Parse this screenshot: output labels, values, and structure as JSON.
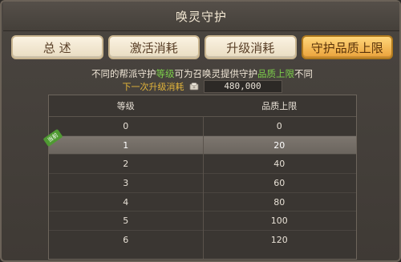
{
  "window": {
    "title": "唤灵守护"
  },
  "tabs": [
    {
      "label": "总  述",
      "active": false
    },
    {
      "label": "激活消耗",
      "active": false
    },
    {
      "label": "升级消耗",
      "active": false
    },
    {
      "label": "守护品质上限",
      "active": true
    }
  ],
  "description": {
    "part1": "不同的帮派守护",
    "highlight1": "等级",
    "part2": "可为召唤灵提供守护",
    "highlight2": "品质上限",
    "part3": "不同"
  },
  "cost": {
    "label": "下一次升级消耗",
    "icon": "coin-icon",
    "value": "480,000"
  },
  "table": {
    "headers": [
      "等级",
      "品质上限"
    ],
    "current_tag": "当前",
    "highlight_row": 1,
    "rows": [
      [
        "0",
        "0"
      ],
      [
        "1",
        "20"
      ],
      [
        "2",
        "40"
      ],
      [
        "3",
        "60"
      ],
      [
        "4",
        "80"
      ],
      [
        "5",
        "100"
      ],
      [
        "6",
        "120"
      ]
    ]
  },
  "colors": {
    "accent": "#eaa23a",
    "highlight_text": "#7ccf4a",
    "cost_label": "#e1b43a"
  }
}
